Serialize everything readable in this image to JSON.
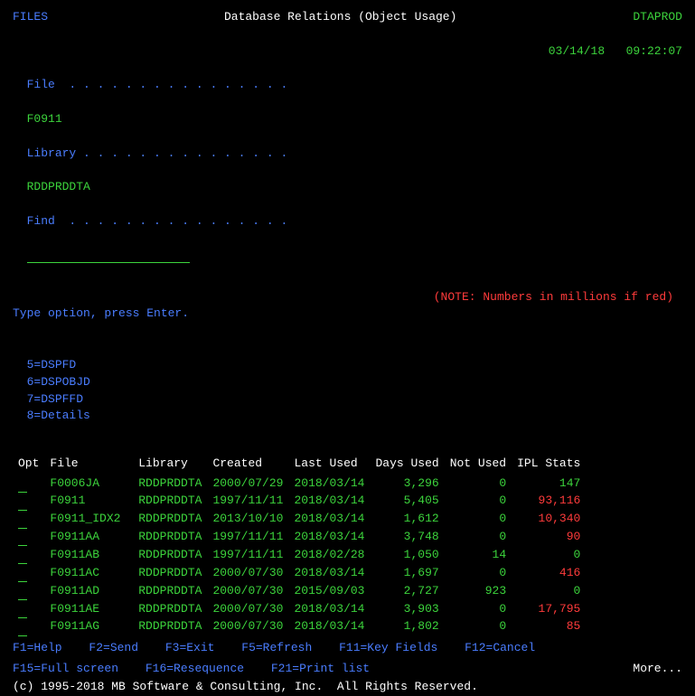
{
  "header": {
    "left": "FILES",
    "title": "Database Relations (Object Usage)",
    "system": "DTAPROD",
    "date": "03/14/18",
    "time": "09:22:07"
  },
  "fields": {
    "file_label": "File  . . . . . . . . . . . . . . . .",
    "file_value": "F0911",
    "library_label": "Library . . . . . . . . . . . . . . .",
    "library_value": "RDDPRDDTA",
    "find_label": "Find  . . . . . . . . . . . . . . . .",
    "find_value": ""
  },
  "note": "(NOTE: Numbers in millions if red)",
  "instructions": {
    "line1": "Type option, press Enter.",
    "opt5": "5=DSPFD",
    "opt6": "6=DSPOBJD",
    "opt7": "7=DSPFFD",
    "opt8": "8=Details"
  },
  "columns": {
    "opt": "Opt",
    "file": "File",
    "library": "Library",
    "created": "Created",
    "last_used": "Last Used",
    "days_used": "Days Used",
    "not_used": "Not Used",
    "ipl_stats": "IPL Stats"
  },
  "rows": [
    {
      "file": "F0006JA",
      "library": "RDDPRDDTA",
      "created": "2000/07/29",
      "last_used": "2018/03/14",
      "days_used": "3,296",
      "not_used": "0",
      "not_used_red": false,
      "ipl_stats": "147",
      "ipl_red": false
    },
    {
      "file": "F0911",
      "library": "RDDPRDDTA",
      "created": "1997/11/11",
      "last_used": "2018/03/14",
      "days_used": "5,405",
      "not_used": "0",
      "not_used_red": false,
      "ipl_stats": "93,116",
      "ipl_red": true
    },
    {
      "file": "F0911_IDX2",
      "library": "RDDPRDDTA",
      "created": "2013/10/10",
      "last_used": "2018/03/14",
      "days_used": "1,612",
      "not_used": "0",
      "not_used_red": false,
      "ipl_stats": "10,340",
      "ipl_red": true
    },
    {
      "file": "F0911AA",
      "library": "RDDPRDDTA",
      "created": "1997/11/11",
      "last_used": "2018/03/14",
      "days_used": "3,748",
      "not_used": "0",
      "not_used_red": false,
      "ipl_stats": "90",
      "ipl_red": true
    },
    {
      "file": "F0911AB",
      "library": "RDDPRDDTA",
      "created": "1997/11/11",
      "last_used": "2018/02/28",
      "days_used": "1,050",
      "not_used": "14",
      "not_used_red": false,
      "ipl_stats": "0",
      "ipl_red": false
    },
    {
      "file": "F0911AC",
      "library": "RDDPRDDTA",
      "created": "2000/07/30",
      "last_used": "2018/03/14",
      "days_used": "1,697",
      "not_used": "0",
      "not_used_red": false,
      "ipl_stats": "416",
      "ipl_red": true
    },
    {
      "file": "F0911AD",
      "library": "RDDPRDDTA",
      "created": "2000/07/30",
      "last_used": "2015/09/03",
      "days_used": "2,727",
      "not_used": "923",
      "not_used_red": false,
      "ipl_stats": "0",
      "ipl_red": false
    },
    {
      "file": "F0911AE",
      "library": "RDDPRDDTA",
      "created": "2000/07/30",
      "last_used": "2018/03/14",
      "days_used": "3,903",
      "not_used": "0",
      "not_used_red": false,
      "ipl_stats": "17,795",
      "ipl_red": true
    },
    {
      "file": "F0911AG",
      "library": "RDDPRDDTA",
      "created": "2000/07/30",
      "last_used": "2018/03/14",
      "days_used": "1,802",
      "not_used": "0",
      "not_used_red": false,
      "ipl_stats": "85",
      "ipl_red": true
    }
  ],
  "fkeys": {
    "f1": "F1=Help",
    "f2": "F2=Send",
    "f3": "F3=Exit",
    "f5": "F5=Refresh",
    "f11": "F11=Key Fields",
    "f12": "F12=Cancel",
    "f15": "F15=Full screen",
    "f16": "F16=Resequence",
    "f21": "F21=Print list",
    "more": "More..."
  },
  "copyright": "(c) 1995-2018 MB Software & Consulting, Inc.  All Rights Reserved."
}
